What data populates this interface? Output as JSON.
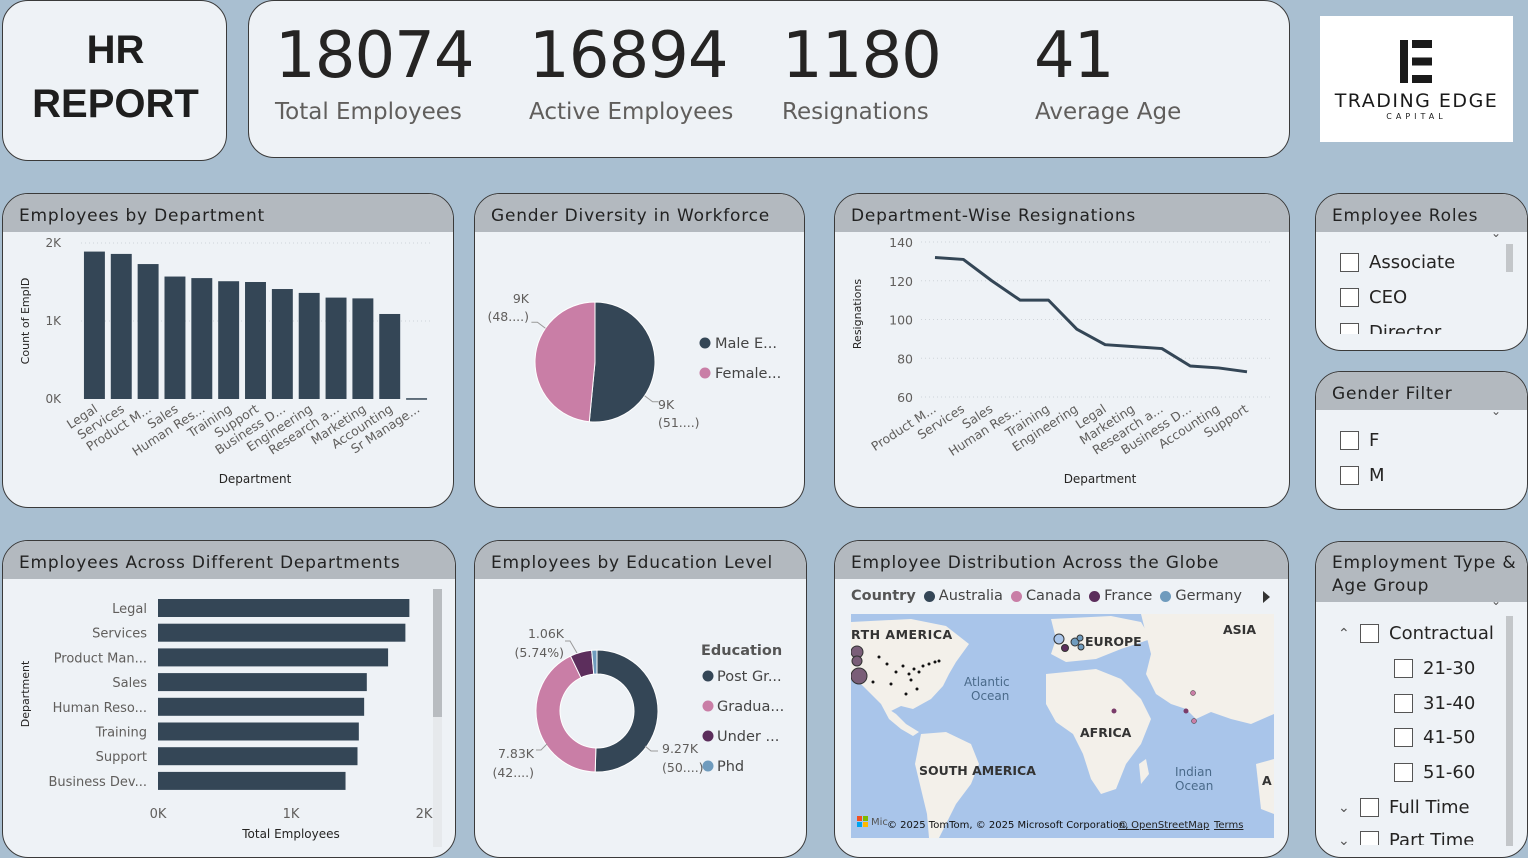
{
  "header": {
    "title_line1": "HR",
    "title_line2": "REPORT"
  },
  "kpis": [
    {
      "value": "18074",
      "label": "Total Employees"
    },
    {
      "value": "16894",
      "label": "Active Employees"
    },
    {
      "value": "1180",
      "label": "Resignations"
    },
    {
      "value": "41",
      "label": "Average Age"
    }
  ],
  "logo": {
    "name": "TRADING EDGE",
    "sub": "CAPITAL"
  },
  "colors": {
    "navy": "#344656",
    "pink": "#c97ea6",
    "purple": "#5c2e5c",
    "blue": "#6f9bbd"
  },
  "chart_data": [
    {
      "type": "bar",
      "title": "Employees by Department",
      "xlabel": "Department",
      "ylabel": "Count of EmpID",
      "ylim": [
        0,
        2000
      ],
      "ytick_labels": [
        "0K",
        "1K",
        "2K"
      ],
      "categories": [
        "Legal",
        "Services",
        "Product M...",
        "Sales",
        "Human Res...",
        "Training",
        "Support",
        "Business D...",
        "Engineering",
        "Research a...",
        "Marketing",
        "Accounting",
        "Sr Manage..."
      ],
      "values": [
        1890,
        1860,
        1730,
        1570,
        1550,
        1510,
        1500,
        1410,
        1360,
        1300,
        1290,
        1090,
        10
      ]
    },
    {
      "type": "pie",
      "title": "Gender Diversity in Workforce",
      "labels": [
        "Male E...",
        "Female..."
      ],
      "values": [
        51,
        48
      ],
      "data_labels": [
        [
          "9K",
          "(51....)"
        ],
        [
          "9K",
          "(48....)"
        ]
      ]
    },
    {
      "type": "line",
      "title": "Department-Wise Resignations",
      "xlabel": "Department",
      "ylabel": "Resignations",
      "ylim": [
        60,
        140
      ],
      "yticks": [
        60,
        80,
        100,
        120,
        140
      ],
      "categories": [
        "Product M...",
        "Services",
        "Sales",
        "Human Res...",
        "Training",
        "Engineering",
        "Legal",
        "Marketing",
        "Research a...",
        "Business D...",
        "Accounting",
        "Support"
      ],
      "values": [
        132,
        131,
        120,
        110,
        110,
        95,
        87,
        86,
        85,
        76,
        75,
        73
      ]
    },
    {
      "type": "bar",
      "orientation": "horizontal",
      "title": "Employees Across Different Departments",
      "xlabel": "Total Employees",
      "ylabel": "Department",
      "xlim": [
        0,
        2000
      ],
      "xtick_labels": [
        "0K",
        "1K",
        "2K"
      ],
      "categories": [
        "Legal",
        "Services",
        "Product Man...",
        "Sales",
        "Human Reso...",
        "Training",
        "Support",
        "Business Dev..."
      ],
      "values": [
        1890,
        1860,
        1730,
        1570,
        1550,
        1510,
        1500,
        1410
      ]
    },
    {
      "type": "pie",
      "donut": true,
      "title": "Employees by Education Level",
      "legend_title": "Education",
      "labels": [
        "Post Gr...",
        "Gradua...",
        "Under ...",
        "Phd"
      ],
      "values": [
        50.5,
        42.4,
        5.74,
        1.4
      ],
      "data_labels": [
        [
          "9.27K",
          "(50....)"
        ],
        [
          "7.83K",
          "(42....)"
        ],
        [
          "1.06K",
          "(5.74%)"
        ]
      ]
    }
  ],
  "map": {
    "title": "Employee Distribution Across the Globe",
    "legend_title": "Country",
    "legend": [
      "Australia",
      "Canada",
      "France",
      "Germany"
    ],
    "labels": {
      "na": "RTH AMERICA",
      "europe": "EUROPE",
      "asia": "ASIA",
      "atlantic1": "Atlantic",
      "atlantic2": "Ocean",
      "africa": "AFRICA",
      "sa": "SOUTH AMERICA",
      "indian1": "Indian",
      "indian2": "Ocean",
      "a": "A"
    },
    "attribution": "© 2025 TomTom, © 2025 Microsoft Corporation,",
    "osm": "© OpenStreetMap",
    "terms": "Terms",
    "ms": "Mic"
  },
  "slicers": {
    "roles": {
      "title": "Employee Roles",
      "items": [
        "Associate",
        "CEO",
        "Director"
      ]
    },
    "gender": {
      "title": "Gender Filter",
      "items": [
        "F",
        "M"
      ]
    },
    "emp_type": {
      "title1": "Employment Type &",
      "title2": "Age Group",
      "items": [
        "Contractual",
        "21-30",
        "31-40",
        "41-50",
        "51-60",
        "Full Time",
        "Part Time"
      ]
    }
  }
}
